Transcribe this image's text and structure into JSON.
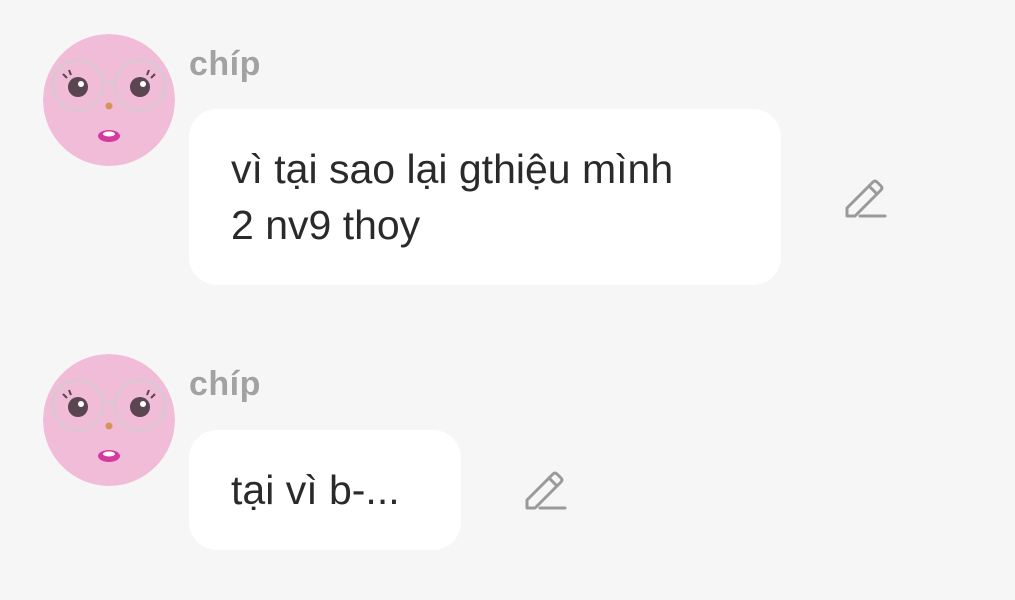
{
  "colors": {
    "background": "#f6f6f6",
    "bubble": "#ffffff",
    "text": "#2a2a2a",
    "sender": "#a2a2a2",
    "icon": "#9a9a9a",
    "avatar": "#f0bcd8"
  },
  "messages": [
    {
      "sender": "chíp",
      "avatar_icon": "pink-face-glasses-avatar",
      "text": "vì tại sao lại gthiệu mình\n2 nv9 thoy",
      "action_icon": "pencil-edit-icon"
    },
    {
      "sender": "chíp",
      "avatar_icon": "pink-face-glasses-avatar",
      "text": "tại vì b-...",
      "action_icon": "pencil-edit-icon"
    }
  ]
}
